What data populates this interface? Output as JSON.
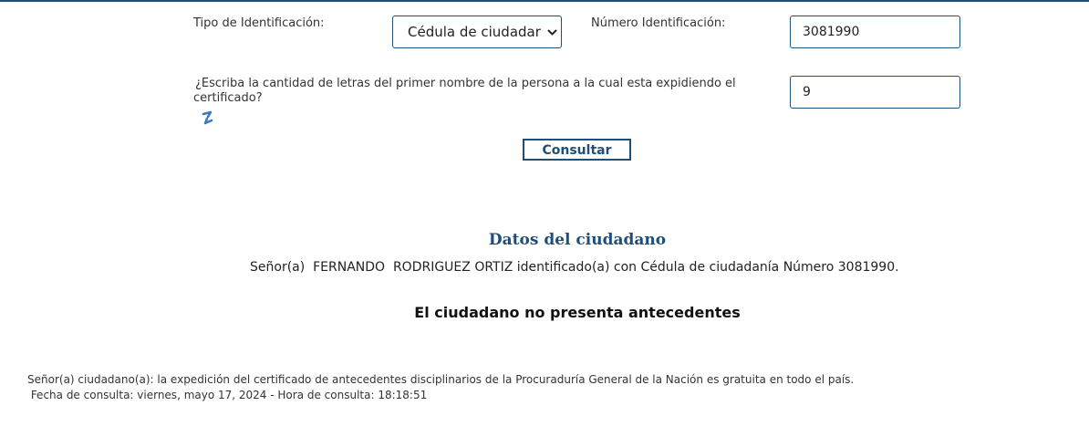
{
  "form": {
    "id_type_label": "Tipo de Identificación:",
    "id_type_value": "Cédula de ciudadar",
    "id_number_label": "Número Identificación:",
    "id_number_value": "3081990",
    "question_line1": "¿Escriba la cantidad de letras del primer nombre de la persona a la cual esta expidiendo el",
    "question_line2": "certificado?",
    "answer_value": "9",
    "refresh_icon": "refresh-icon",
    "submit_label": "Consultar"
  },
  "result": {
    "section_title": "Datos del ciudadano",
    "citizen_text": "Señor(a)  FERNANDO  RODRIGUEZ ORTIZ identificado(a) con Cédula de ciudadanía Número 3081990.",
    "status_text": "El ciudadano no presenta antecedentes"
  },
  "footer": {
    "notice": "Señor(a) ciudadano(a): la expedición del certificado de antecedentes disciplinarios de la Procuraduría General de la Nación es gratuita en todo el país.",
    "consult_date": " Fecha de consulta: viernes, mayo 17, 2024 - Hora de consulta: 18:18:51"
  },
  "colors": {
    "accent": "#1f4e79",
    "refresh_icon": "#3a78c2"
  }
}
